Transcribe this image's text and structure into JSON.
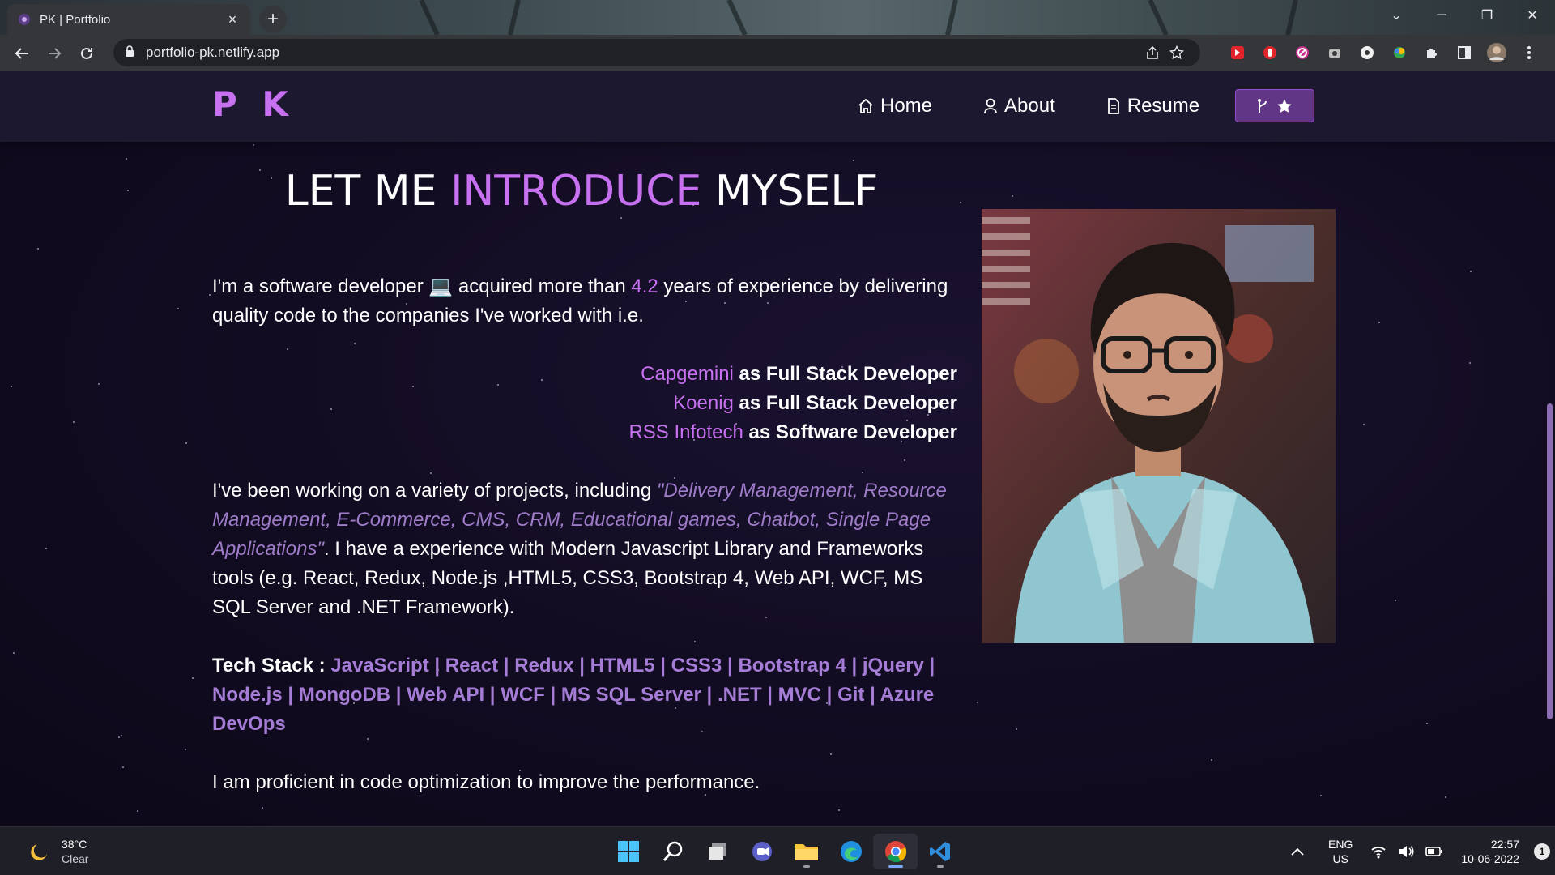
{
  "browser": {
    "tab_title": "PK | Portfolio",
    "url": "portfolio-pk.netlify.app",
    "new_tab_symbol": "+",
    "close_symbol": "×"
  },
  "site": {
    "logo": "P K",
    "nav": [
      {
        "label": "Home",
        "icon": "home-icon"
      },
      {
        "label": "About",
        "icon": "user-icon"
      },
      {
        "label": "Resume",
        "icon": "document-icon"
      }
    ],
    "github_button_icons": [
      "git-fork-icon",
      "star-icon"
    ]
  },
  "intro": {
    "title_part1": "LET ME ",
    "title_highlight": "INTRODUCE",
    "title_part2": " MYSELF",
    "p1_before": "I'm a software developer ",
    "p1_emoji": "💻",
    "p1_middle": " acquired more than ",
    "p1_years": "4.2",
    "p1_after": " years of experience by delivering quality code to the companies I've worked with i.e.",
    "companies": [
      {
        "name": "Capgemini",
        "role": " as Full Stack Developer"
      },
      {
        "name": "Koenig",
        "role": " as Full Stack Developer"
      },
      {
        "name": "RSS Infotech",
        "role": " as Software Developer"
      }
    ],
    "p2_before": "I've been working on a variety of projects, including ",
    "p2_projects": "\"Delivery Management, Resource Management, E-Commerce, CMS, CRM, Educational games, Chatbot, Single Page Applications\"",
    "p2_after": ". I have a experience with Modern Javascript Library and Frameworks tools (e.g. React, Redux, Node.js ,HTML5, CSS3, Bootstrap 4, Web API, WCF, MS SQL Server and .NET Framework).",
    "tech_label": "Tech Stack : ",
    "tech_stack": [
      "JavaScript",
      "React",
      "Redux",
      "HTML5",
      "CSS3",
      "Bootstrap 4",
      "jQuery",
      "Node.js",
      "MongoDB",
      "Web API",
      "WCF",
      "MS SQL Server",
      ".NET",
      "MVC",
      "Git",
      "Azure DevOps"
    ],
    "tech_separator": " | ",
    "p3": "I am proficient in code optimization to improve the performance."
  },
  "taskbar": {
    "weather_temp": "38°C",
    "weather_cond": "Clear",
    "apps": [
      "windows-start-icon",
      "search-icon",
      "task-view-icon",
      "chat-icon",
      "file-explorer-icon",
      "edge-icon",
      "chrome-icon",
      "vscode-icon"
    ],
    "lang_1": "ENG",
    "lang_2": "US",
    "time": "22:57",
    "date": "10-06-2022",
    "notification_count": "1"
  },
  "colors": {
    "accent_purple": "#c770f0",
    "tech_purple": "#a67dd6",
    "italic_purple": "#9f7cc9",
    "nav_bg": "#1c1830",
    "page_bg": "#120c22",
    "button_bg": "#623686"
  }
}
